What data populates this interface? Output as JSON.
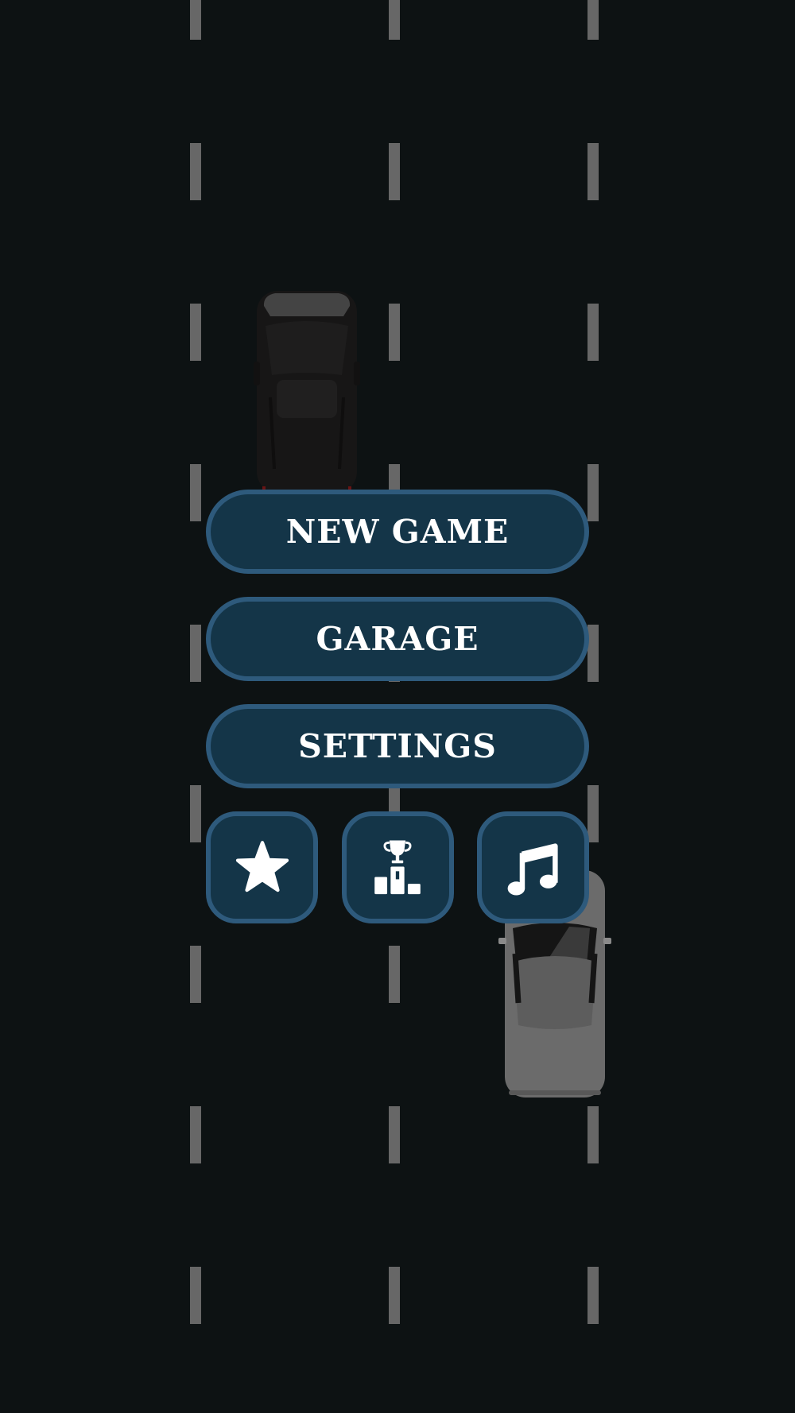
{
  "menu": {
    "new_game_label": "NEW GAME",
    "garage_label": "GARAGE",
    "settings_label": "SETTINGS"
  },
  "icon_buttons": [
    {
      "name": "star-icon",
      "meaning": "rate"
    },
    {
      "name": "podium-trophy-icon",
      "meaning": "leaderboard"
    },
    {
      "name": "music-note-icon",
      "meaning": "music"
    }
  ],
  "colors": {
    "background": "#0d1213",
    "lane_marking": "#676767",
    "button_fill": "#143548",
    "button_border": "#2e5a7c",
    "button_text": "#ffffff",
    "dark_car": "#161515",
    "grey_car": "#6b6b6b"
  }
}
